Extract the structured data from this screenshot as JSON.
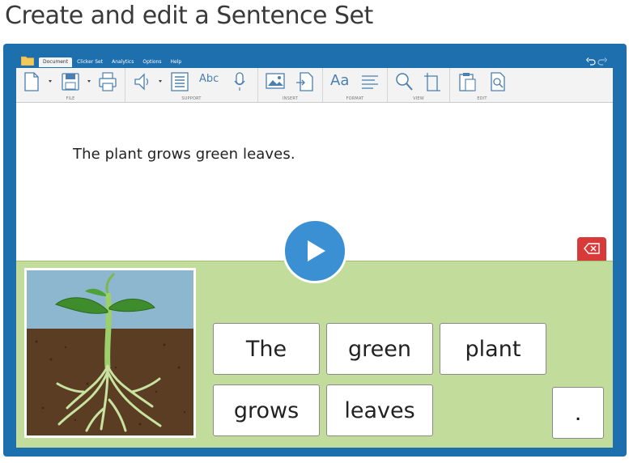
{
  "page": {
    "title": "Create and edit a Sentence Set"
  },
  "menu": {
    "tabs": [
      {
        "label": "Document"
      },
      {
        "label": "Clicker Set"
      },
      {
        "label": "Analytics"
      },
      {
        "label": "Options"
      },
      {
        "label": "Help"
      }
    ],
    "active_tab": "Document"
  },
  "ribbon": {
    "groups": [
      {
        "label": "FILE",
        "icons": [
          "new-document-icon",
          "save-icon",
          "print-icon"
        ]
      },
      {
        "label": "SUPPORT",
        "icons": [
          "speaker-icon",
          "word-list-icon",
          "spellcheck-icon",
          "microphone-icon"
        ]
      },
      {
        "label": "INSERT",
        "icons": [
          "insert-picture-icon",
          "insert-file-icon"
        ]
      },
      {
        "label": "FORMAT",
        "icons": [
          "font-icon",
          "align-icon"
        ]
      },
      {
        "label": "VIEW",
        "icons": [
          "zoom-icon",
          "page-size-icon"
        ]
      },
      {
        "label": "EDIT",
        "icons": [
          "paste-icon",
          "find-icon"
        ]
      }
    ],
    "spellcheck_glyph": "Abc",
    "font_glyph": "Aa"
  },
  "document": {
    "sentence": "The plant grows green leaves."
  },
  "grid": {
    "picture": "plant-growing-from-soil",
    "words": [
      "The",
      "green",
      "plant",
      "grows",
      "leaves"
    ],
    "punctuation": "."
  },
  "colors": {
    "frame": "#1d6fae",
    "grid_background": "#c2dd9b",
    "play_button": "#3b8fd3",
    "clear_button": "#d83a3a"
  }
}
